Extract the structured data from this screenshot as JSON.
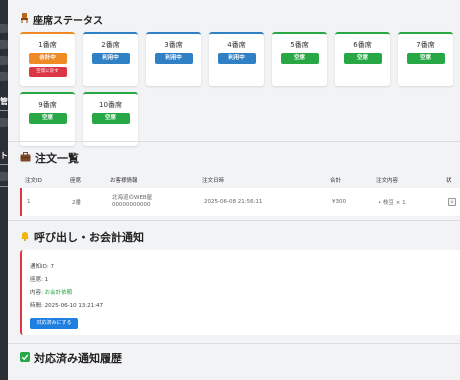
{
  "sidebar": {
    "labels": [
      "管",
      "ト"
    ]
  },
  "seat_section": {
    "title": "座席ステータス",
    "icon": "chair-icon"
  },
  "seats": [
    {
      "name": "1番席",
      "status": "会計中",
      "status_type": "bill",
      "action": "空席に戻す"
    },
    {
      "name": "2番席",
      "status": "利用中",
      "status_type": "use"
    },
    {
      "name": "3番席",
      "status": "利用中",
      "status_type": "use"
    },
    {
      "name": "4番席",
      "status": "利用中",
      "status_type": "use"
    },
    {
      "name": "5番席",
      "status": "空席",
      "status_type": "empty"
    },
    {
      "name": "6番席",
      "status": "空席",
      "status_type": "empty"
    },
    {
      "name": "7番席",
      "status": "空席",
      "status_type": "empty"
    },
    {
      "name": "9番席",
      "status": "空席",
      "status_type": "empty"
    },
    {
      "name": "10番席",
      "status": "空席",
      "status_type": "empty"
    }
  ],
  "orders_section": {
    "title": "注文一覧",
    "icon": "briefcase-icon"
  },
  "orders_table": {
    "headers": [
      "注文ID",
      "座席",
      "お客様情報",
      "注文日時",
      "合計",
      "注文内容",
      "状"
    ],
    "rows": [
      {
        "id": "1",
        "seat": "2番",
        "customer_name": "北海道のWEB屋",
        "customer_phone": "00000000000",
        "datetime": "2025-06-08 21:56:11",
        "total": "¥300",
        "items": "• 枝豆 × 1",
        "action": "∧"
      }
    ]
  },
  "notify_section": {
    "title": "呼び出し・お会計通知",
    "icon": "bell-icon"
  },
  "notification": {
    "id_line": "通知ID: 7",
    "seat_line": "座席: 1",
    "content_label": "内容: ",
    "content_value": "お会計依頼",
    "time_line": "時間: 2025-06-10 13:21:47",
    "button": "対応済みにする"
  },
  "history_section": {
    "title": "対応済み通知履歴",
    "icon": "check-icon"
  },
  "colors": {
    "green": "#28a745",
    "blue": "#2f80c5",
    "orange": "#f08a24",
    "red": "#dc3545",
    "button_blue": "#1e7fe0"
  }
}
